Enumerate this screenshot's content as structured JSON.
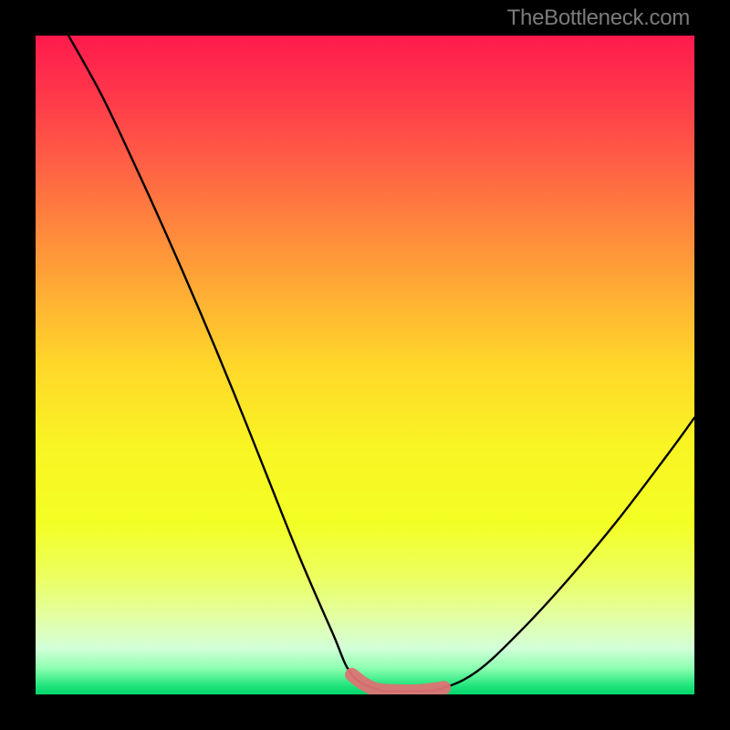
{
  "watermark": "TheBottleneck.com",
  "chart_data": {
    "type": "line",
    "title": "",
    "xlabel": "",
    "ylabel": "",
    "xlim": [
      0,
      100
    ],
    "ylim": [
      0,
      100
    ],
    "grid": false,
    "legend": false,
    "background_gradient": {
      "top": "#ff1a4d",
      "mid": "#ffd72a",
      "bottom": "#00d56b"
    },
    "series": [
      {
        "name": "bottleneck-curve",
        "color": "#000000",
        "x": [
          5,
          10,
          15,
          20,
          25,
          30,
          35,
          40,
          45,
          48,
          52,
          55,
          58,
          62,
          67,
          73,
          80,
          88,
          96,
          100
        ],
        "y": [
          100,
          91,
          80.5,
          69.5,
          58,
          46,
          33.5,
          21,
          9.5,
          3,
          0.7,
          0.5,
          0.5,
          1,
          3.5,
          9,
          16.5,
          26,
          36.5,
          42
        ]
      },
      {
        "name": "optimal-range-highlight",
        "color": "#e06666",
        "x": [
          48,
          50,
          52,
          55,
          58,
          60,
          62
        ],
        "y": [
          3,
          1.5,
          0.7,
          0.5,
          0.5,
          0.7,
          1
        ]
      }
    ],
    "annotations": []
  }
}
